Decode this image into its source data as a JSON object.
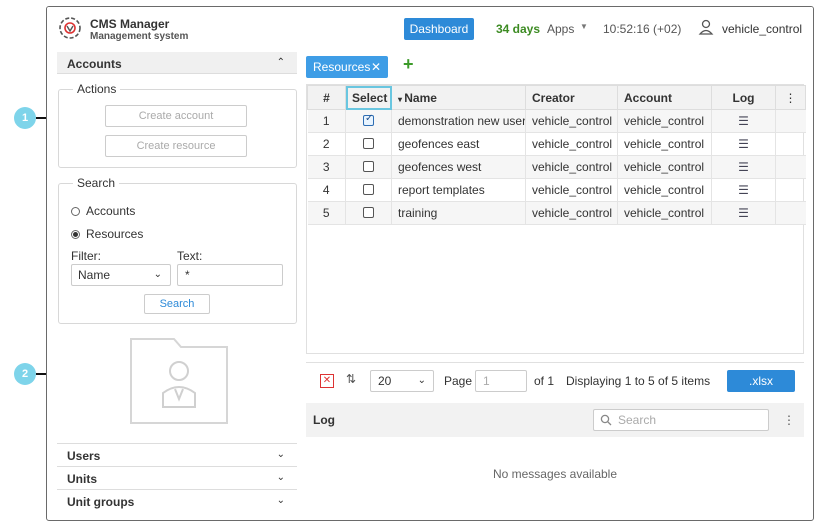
{
  "header": {
    "title": "CMS Manager",
    "subtitle": "Management system",
    "dashboard": "Dashboard",
    "days": "34 days",
    "apps": "Apps",
    "clock": "10:52:16 (+02)",
    "user": "vehicle_control"
  },
  "left": {
    "accounts_title": "Accounts",
    "actions_legend": "Actions",
    "create_account": "Create account",
    "create_resource": "Create resource",
    "search_legend": "Search",
    "radio_accounts": "Accounts",
    "radio_resources": "Resources",
    "filter_label": "Filter:",
    "text_label": "Text:",
    "filter_value": "Name",
    "text_value": "*",
    "search_button": "Search",
    "sections": [
      "Users",
      "Units",
      "Unit groups"
    ]
  },
  "right": {
    "tab_label": "Resources",
    "columns": [
      "#",
      "Select",
      "Name",
      "Creator",
      "Account",
      "Log"
    ],
    "rows": [
      {
        "n": "1",
        "name": "demonstration new users",
        "creator": "vehicle_control",
        "account": "vehicle_control",
        "checked": true
      },
      {
        "n": "2",
        "name": "geofences east",
        "creator": "vehicle_control",
        "account": "vehicle_control",
        "checked": false
      },
      {
        "n": "3",
        "name": "geofences west",
        "creator": "vehicle_control",
        "account": "vehicle_control",
        "checked": false
      },
      {
        "n": "4",
        "name": "report templates",
        "creator": "vehicle_control",
        "account": "vehicle_control",
        "checked": false
      },
      {
        "n": "5",
        "name": "training",
        "creator": "vehicle_control",
        "account": "vehicle_control",
        "checked": false
      }
    ],
    "page_size": "20",
    "page_label": "Page",
    "page_value": "1",
    "of_label": "of 1",
    "displaying": "Displaying 1 to 5 of 5 items",
    "export": ".xlsx",
    "log_title": "Log",
    "search_placeholder": "Search",
    "no_messages": "No messages available"
  },
  "callouts": [
    "1",
    "2"
  ],
  "colors": {
    "primary": "#2d8ad8",
    "tab": "#3e9de6",
    "days_green": "#3c8b22",
    "callout": "#7ed4ea",
    "add_green": "#3c9b2a"
  }
}
